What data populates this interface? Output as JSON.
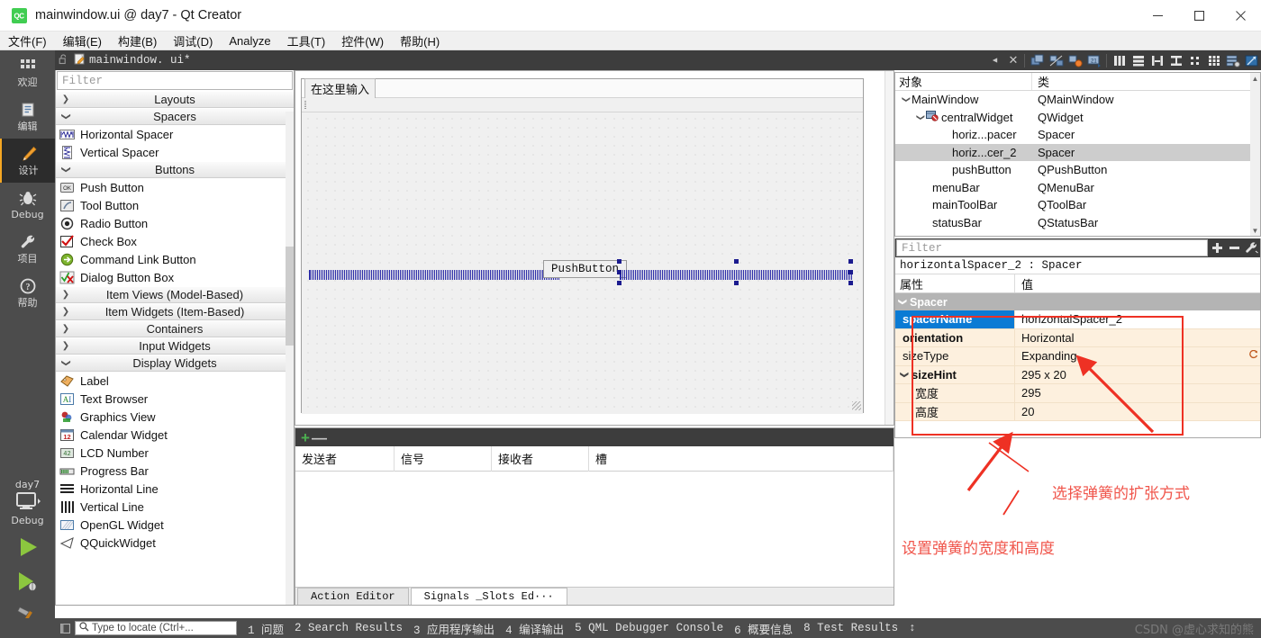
{
  "window": {
    "title": "mainwindow.ui @ day7 - Qt Creator",
    "logo_text": "QC",
    "minimize": "–",
    "maximize": "❐",
    "close": "✕"
  },
  "menubar": {
    "items": [
      {
        "label": "文件(F)",
        "name": "menu-file"
      },
      {
        "label": "编辑(E)",
        "name": "menu-edit"
      },
      {
        "label": "构建(B)",
        "name": "menu-build"
      },
      {
        "label": "调试(D)",
        "name": "menu-debug"
      },
      {
        "label": "Analyze",
        "name": "menu-analyze"
      },
      {
        "label": "工具(T)",
        "name": "menu-tools"
      },
      {
        "label": "控件(W)",
        "name": "menu-window"
      },
      {
        "label": "帮助(H)",
        "name": "menu-help"
      }
    ]
  },
  "modebar": {
    "modes": [
      {
        "label": "欢迎",
        "icon": "grid-icon",
        "active": false
      },
      {
        "label": "编辑",
        "icon": "document-icon",
        "active": false
      },
      {
        "label": "设计",
        "icon": "pencil-icon",
        "active": true
      },
      {
        "label": "Debug",
        "icon": "bug-icon",
        "active": false
      },
      {
        "label": "项目",
        "icon": "wrench-icon",
        "active": false
      },
      {
        "label": "帮助",
        "icon": "question-icon",
        "active": false
      }
    ],
    "kit_name": "day7",
    "kit_config": "Debug",
    "run_label": "run-button",
    "debug_label": "start-debugging-button",
    "build_label": "build-button"
  },
  "widgetbox": {
    "filter_placeholder": "Filter",
    "groups": [
      {
        "label": "Layouts",
        "expanded": false,
        "items": []
      },
      {
        "label": "Spacers",
        "expanded": true,
        "items": [
          {
            "label": "Horizontal Spacer",
            "icon": "horizontal-spacer-icon"
          },
          {
            "label": "Vertical Spacer",
            "icon": "vertical-spacer-icon"
          }
        ]
      },
      {
        "label": "Buttons",
        "expanded": true,
        "items": [
          {
            "label": "Push Button",
            "icon": "push-button-icon"
          },
          {
            "label": "Tool Button",
            "icon": "tool-button-icon"
          },
          {
            "label": "Radio Button",
            "icon": "radio-button-icon"
          },
          {
            "label": "Check Box",
            "icon": "check-box-icon"
          },
          {
            "label": "Command Link Button",
            "icon": "command-link-icon"
          },
          {
            "label": "Dialog Button Box",
            "icon": "dialog-button-box-icon"
          }
        ]
      },
      {
        "label": "Item Views (Model-Based)",
        "expanded": false,
        "items": []
      },
      {
        "label": "Item Widgets (Item-Based)",
        "expanded": false,
        "items": []
      },
      {
        "label": "Containers",
        "expanded": false,
        "items": []
      },
      {
        "label": "Input Widgets",
        "expanded": false,
        "items": []
      },
      {
        "label": "Display Widgets",
        "expanded": true,
        "items": [
          {
            "label": "Label",
            "icon": "label-icon"
          },
          {
            "label": "Text Browser",
            "icon": "text-browser-icon"
          },
          {
            "label": "Graphics View",
            "icon": "graphics-view-icon"
          },
          {
            "label": "Calendar Widget",
            "icon": "calendar-icon"
          },
          {
            "label": "LCD Number",
            "icon": "lcd-number-icon"
          },
          {
            "label": "Progress Bar",
            "icon": "progress-bar-icon"
          },
          {
            "label": "Horizontal Line",
            "icon": "horizontal-line-icon"
          },
          {
            "label": "Vertical Line",
            "icon": "vertical-line-icon"
          },
          {
            "label": "OpenGL Widget",
            "icon": "opengl-widget-icon"
          },
          {
            "label": "QQuickWidget",
            "icon": "qquickwidget-icon"
          }
        ]
      }
    ]
  },
  "editor_toolbar": {
    "lock_icon": "unlock-icon",
    "file_icon": "ui-file-icon",
    "filename": "mainwindow. ui*",
    "dropdown_icon": "chevron-down-icon",
    "close_icon": "close-icon",
    "tools": [
      {
        "name": "edit-widgets-icon"
      },
      {
        "name": "edit-signals-slots-icon"
      },
      {
        "name": "edit-buddies-icon"
      },
      {
        "name": "edit-tab-order-icon"
      },
      {
        "name": "layout-horizontally-icon"
      },
      {
        "name": "layout-vertically-icon"
      },
      {
        "name": "layout-splitter-horizontal-icon"
      },
      {
        "name": "layout-splitter-vertical-icon"
      },
      {
        "name": "layout-form-icon"
      },
      {
        "name": "layout-grid-icon"
      },
      {
        "name": "break-layout-icon"
      },
      {
        "name": "adjust-size-icon"
      }
    ]
  },
  "form": {
    "menu_placeholder": "在这里输入",
    "pushbutton_label": "PushButton",
    "spacer1_name": "horizontalSpacer",
    "spacer2_name": "horizontalSpacer_2"
  },
  "signals_slots": {
    "add_label": "+",
    "remove_label": "—",
    "columns": [
      "发送者",
      "信号",
      "接收者",
      "槽"
    ],
    "rows": [],
    "tabs": [
      {
        "label": "Action Editor",
        "active": false
      },
      {
        "label": "Signals _Slots Ed···",
        "active": true
      }
    ]
  },
  "object_tree": {
    "headers": [
      "对象",
      "类"
    ],
    "rows": [
      {
        "name": "MainWindow",
        "class": "QMainWindow",
        "indent": 0,
        "arrow": "˅",
        "icon": "",
        "selected": false
      },
      {
        "name": "centralWidget",
        "class": "QWidget",
        "indent": 1,
        "arrow": "˅",
        "icon": "widget-nolayout-icon",
        "selected": false
      },
      {
        "name": "horiz...pacer",
        "class": "Spacer",
        "indent": 3,
        "arrow": "",
        "icon": "",
        "selected": false
      },
      {
        "name": "horiz...cer_2",
        "class": "Spacer",
        "indent": 3,
        "arrow": "",
        "icon": "",
        "selected": true
      },
      {
        "name": "pushButton",
        "class": "QPushButton",
        "indent": 3,
        "arrow": "",
        "icon": "",
        "selected": false
      },
      {
        "name": "menuBar",
        "class": "QMenuBar",
        "indent": 2,
        "arrow": "",
        "icon": "",
        "selected": false
      },
      {
        "name": "mainToolBar",
        "class": "QToolBar",
        "indent": 2,
        "arrow": "",
        "icon": "",
        "selected": false
      },
      {
        "name": "statusBar",
        "class": "QStatusBar",
        "indent": 2,
        "arrow": "",
        "icon": "",
        "selected": false
      }
    ]
  },
  "property_editor": {
    "filter_placeholder": "Filter",
    "add_icon": "plus-icon",
    "remove_icon": "minus-icon",
    "config_icon": "wrench-icon",
    "object_line": "horizontalSpacer_2 : Spacer",
    "headers": [
      "属性",
      "值"
    ],
    "group": "Spacer",
    "rows": [
      {
        "key": "spacerName",
        "value": "horizontalSpacer_2",
        "bold": true,
        "selected": true,
        "sub": false,
        "arrow": ""
      },
      {
        "key": "orientation",
        "value": "Horizontal",
        "bold": true,
        "selected": false,
        "sub": false,
        "arrow": ""
      },
      {
        "key": "sizeType",
        "value": "Expanding",
        "bold": false,
        "selected": false,
        "sub": false,
        "arrow": ""
      },
      {
        "key": "sizeHint",
        "value": "295 x 20",
        "bold": true,
        "selected": false,
        "sub": false,
        "arrow": "˅"
      },
      {
        "key": "宽度",
        "value": "295",
        "bold": false,
        "selected": false,
        "sub": true,
        "arrow": ""
      },
      {
        "key": "高度",
        "value": "20",
        "bold": false,
        "selected": false,
        "sub": true,
        "arrow": ""
      }
    ]
  },
  "annotations": {
    "note_sizetype": "选择弹簧的扩张方式",
    "note_sizehint": "设置弹簧的宽度和高度",
    "box_color": "#ee3124",
    "text_color": "#f0554b"
  },
  "statusbar": {
    "square_icon": "output-pane-toggle-icon",
    "locate_icon": "search-icon",
    "locate_placeholder": "Type to locate (Ctrl+...",
    "panes": [
      "1 问题",
      "2 Search Results",
      "3 应用程序输出",
      "4 编译输出",
      "5 QML Debugger Console",
      "6 概要信息",
      "8 Test Results"
    ],
    "updown_icon": "↕",
    "watermark": "CSDN @虚心求知的熊"
  }
}
